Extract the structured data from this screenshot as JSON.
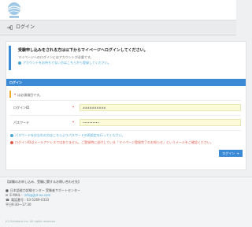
{
  "header": {
    "logo_alt": "globe-logo"
  },
  "page": {
    "title": "ログイン"
  },
  "notice": {
    "title": "受験申し込みをされる方は以下からマイページへログインしてください。",
    "text": "マイページへのログインにはアカウントが必要です。",
    "link": "アカウントをお持ちでない方はこちらから登録してください。"
  },
  "panel": {
    "heading": "ログイン",
    "required_note": "は必須項目です。",
    "required_mark": "*"
  },
  "form": {
    "login_id": {
      "label": "ログインID",
      "value": "##########"
    },
    "password": {
      "label": "パスワード",
      "value": "••••••••••"
    }
  },
  "messages": {
    "forgot": "パスワードをお忘れの方はこちらよりパスワードの再設定を行ってください。",
    "notice_email": "ログインIDはメールアドレスではありません。ご登録時に送付している「マイページ登録完了のお知らせ」というメールをご確認ください。"
  },
  "login_button": {
    "label": "ログイン"
  },
  "footer": {
    "title": "【試験のお申し込み、受験に関するお問い合わせ先】",
    "org": "日本語能力試験センター 受験者サポートセンター",
    "email_label": "E-MAIL :",
    "email": "info@jlpt-ex.com",
    "phone": "電話番号 : 03-5269-0333",
    "hours": "平日9:30～17:30",
    "copyright": "(C) Solutions Inc. All rights reserved."
  },
  "colors": {
    "accent": "#3b8ad6",
    "info": "#49a6d8",
    "alert": "#e15a4a",
    "input_bg": "#fbfbd8"
  }
}
